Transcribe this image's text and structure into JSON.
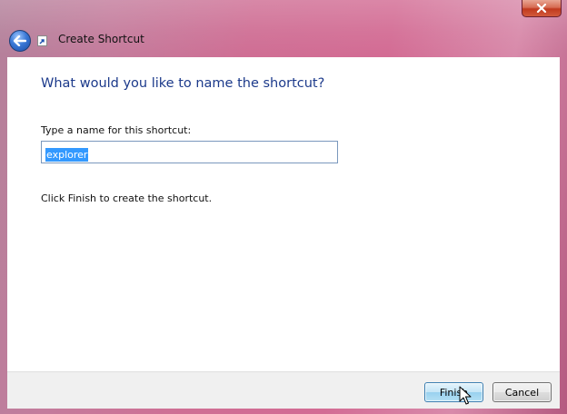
{
  "window": {
    "title": "Create Shortcut",
    "close_icon": "close-x-icon",
    "back_icon": "back-arrow-icon",
    "title_icon": "shortcut-icon",
    "frame_color": "#d36c94"
  },
  "main": {
    "heading": "What would you like to name the shortcut?",
    "name_label": "Type a name for this shortcut:",
    "name_value": "explorer",
    "instruction": "Click Finish to create the shortcut."
  },
  "footer": {
    "finish_label": "Finish",
    "cancel_label": "Cancel"
  },
  "colors": {
    "heading": "#1c3a8b",
    "selection": "#3399ff"
  }
}
